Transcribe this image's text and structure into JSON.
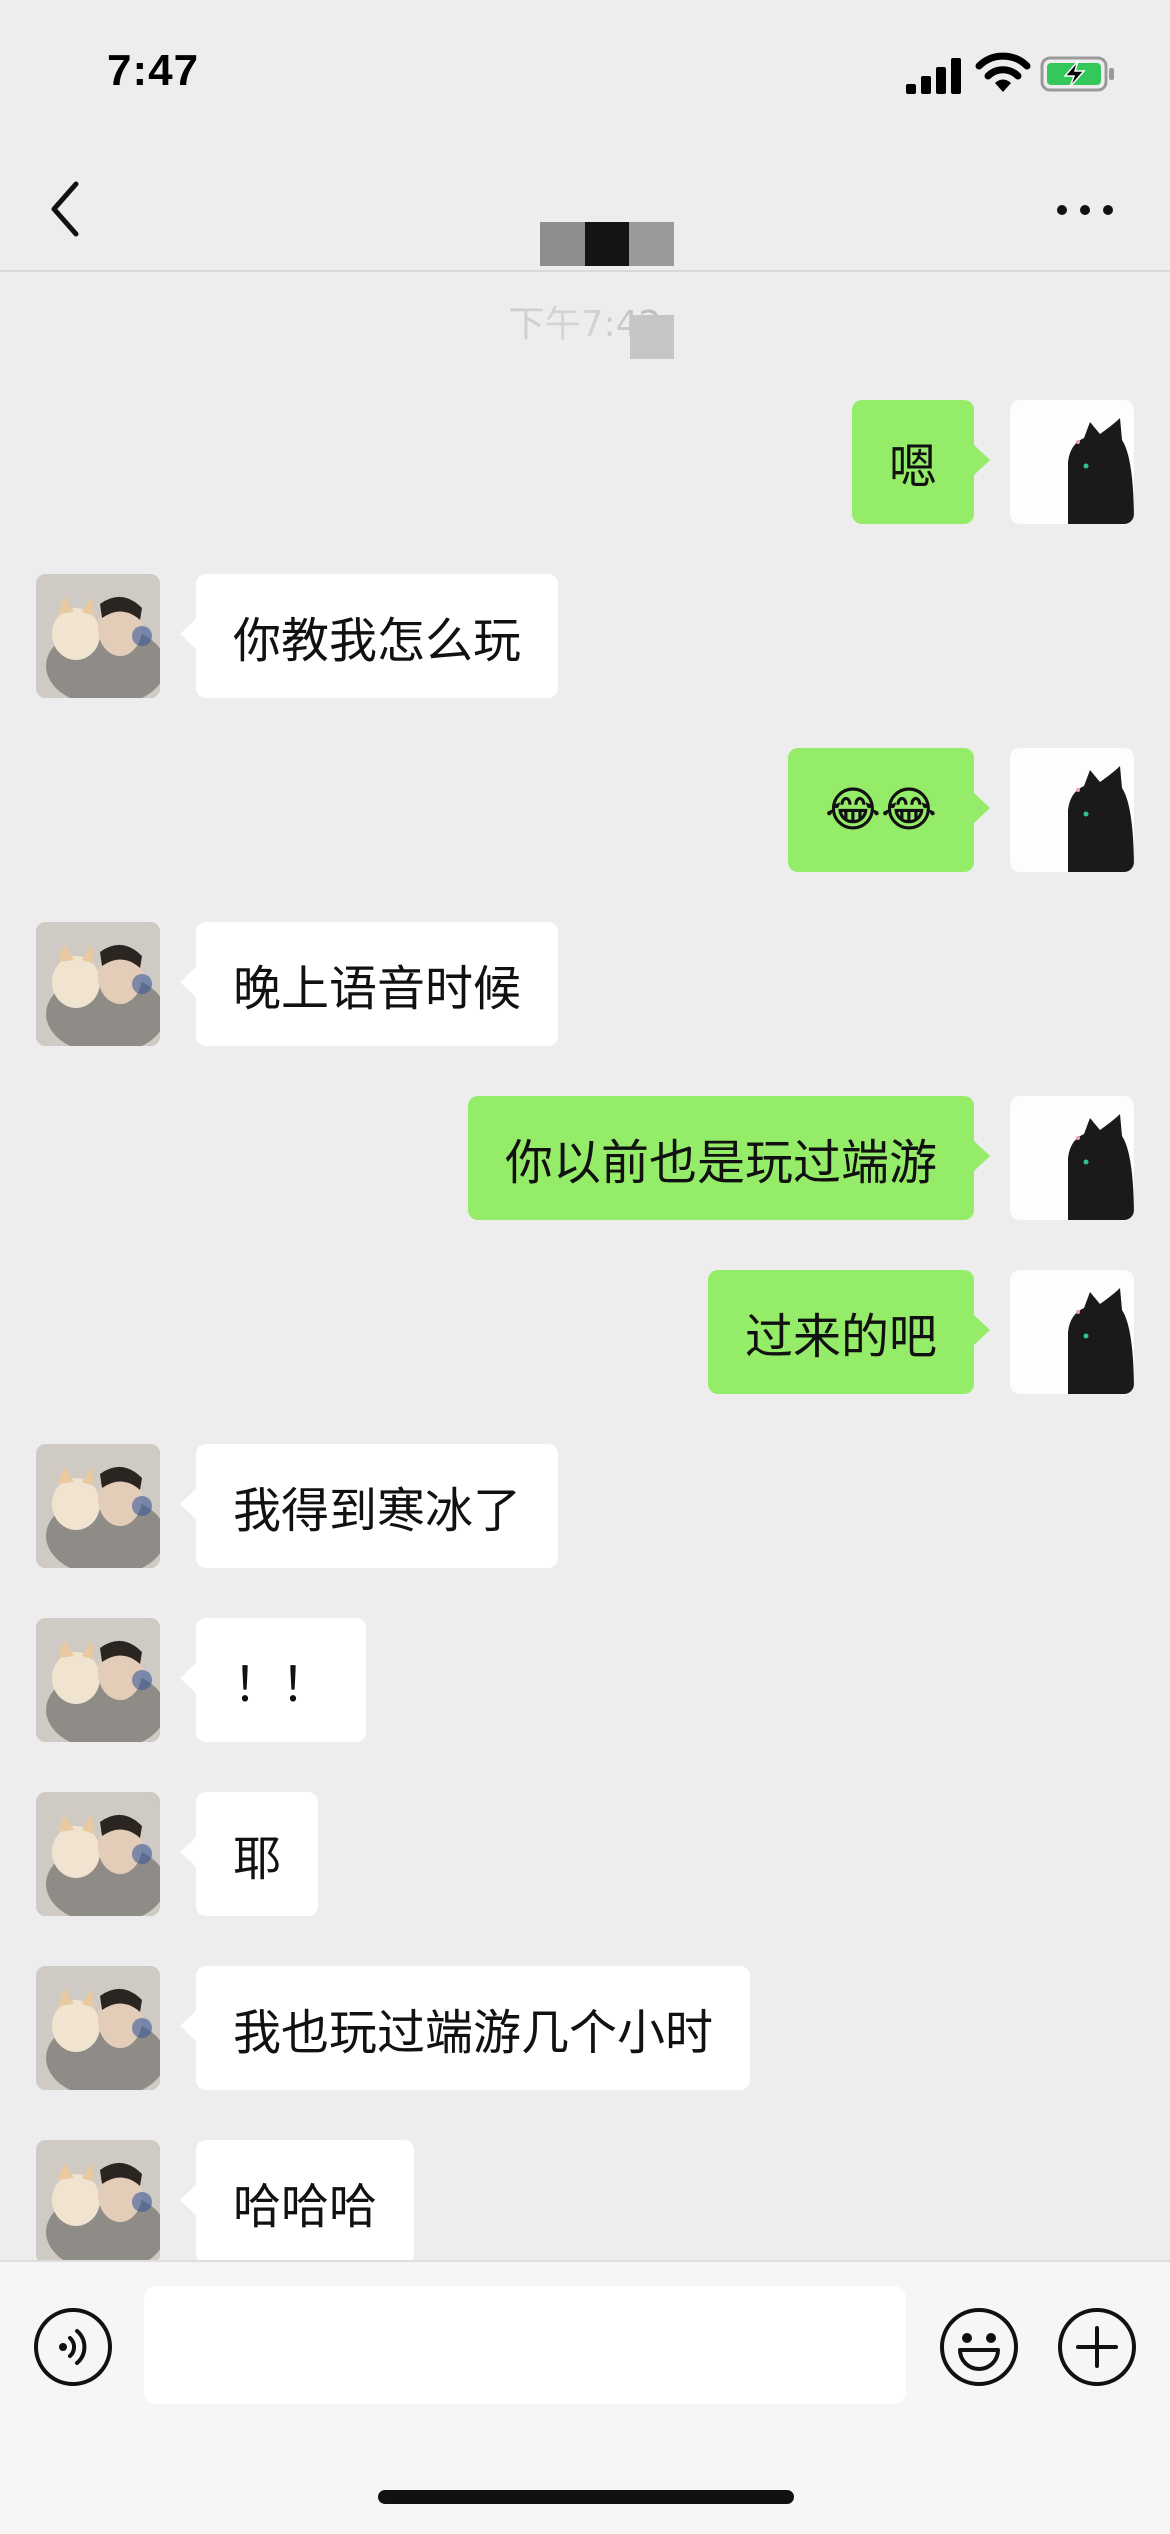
{
  "status_bar": {
    "time": "7:47",
    "icons": [
      "cellular-signal-icon",
      "wifi-icon",
      "battery-charging-icon"
    ],
    "battery_color": "#34c759"
  },
  "nav": {
    "back_icon": "chevron-left-icon",
    "more_icon": "more-dots-icon",
    "title": "",
    "title_obscured": true
  },
  "timestamp": "下午7:42",
  "messages": [
    {
      "side": "out",
      "text": "嗯"
    },
    {
      "side": "in",
      "text": "你教我怎么玩"
    },
    {
      "side": "out",
      "text": "😂😂",
      "emoji": "face-with-tears-of-joy-icon"
    },
    {
      "side": "in",
      "text": "晚上语音时候"
    },
    {
      "side": "out",
      "text": "你以前也是玩过端游"
    },
    {
      "side": "out",
      "text": "过来的吧"
    },
    {
      "side": "in",
      "text": "我得到寒冰了"
    },
    {
      "side": "in",
      "text": "！！"
    },
    {
      "side": "in",
      "text": "耶"
    },
    {
      "side": "in",
      "text": "我也玩过端游几个小时"
    },
    {
      "side": "in",
      "text": "哈哈哈"
    }
  ],
  "input_bar": {
    "voice_icon": "voice-input-icon",
    "input_value": "",
    "emoji_icon": "emoji-icon",
    "plus_icon": "plus-circle-icon"
  },
  "colors": {
    "background": "#ededed",
    "outgoing_bubble": "#95ec69",
    "incoming_bubble": "#ffffff"
  }
}
